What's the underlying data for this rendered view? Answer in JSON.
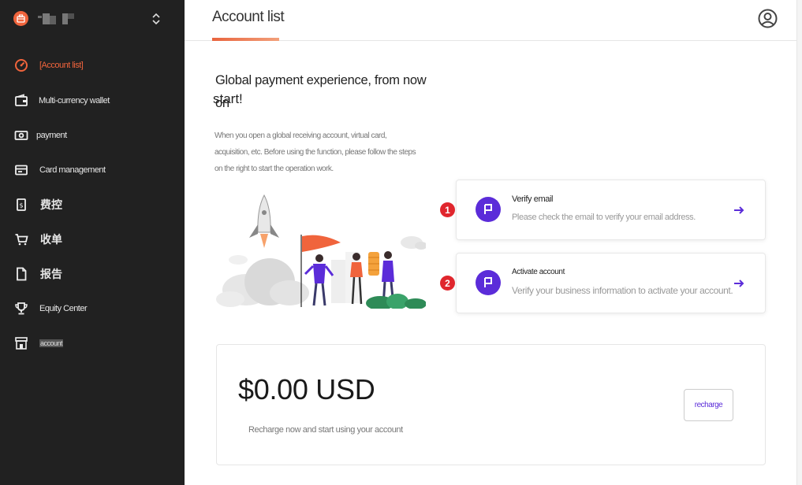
{
  "sidebar": {
    "items": [
      {
        "label": "[Account list]",
        "icon": "gauge-icon",
        "active": true
      },
      {
        "label": "Multi-currency wallet",
        "icon": "wallet-icon"
      },
      {
        "label": "payment",
        "icon": "banknote-icon"
      },
      {
        "label": "Card management",
        "icon": "card-icon"
      },
      {
        "label": "费控",
        "icon": "receipt-icon"
      },
      {
        "label": "收单",
        "icon": "cart-icon"
      },
      {
        "label": "报告",
        "icon": "report-icon"
      },
      {
        "label": "Equity Center",
        "icon": "trophy-icon"
      },
      {
        "label": "account",
        "icon": "store-icon"
      }
    ]
  },
  "header": {
    "title": "Account list",
    "avatar_icon": "user-circle-icon"
  },
  "hero": {
    "title_line1": "Global payment experience, from now on",
    "title_line2": "start!",
    "description": "When you open a global receiving account, virtual card, acquisition, etc. Before using the function, please follow the steps on the right to start the operation work."
  },
  "steps": [
    {
      "number": "1",
      "title": "Verify email",
      "description": "Please check the email to verify your email address.",
      "icon": "flag-icon"
    },
    {
      "number": "2",
      "title": "Activate account",
      "description": "Verify your business information to activate your account.",
      "icon": "flag-icon"
    }
  ],
  "balance": {
    "amount": "$0.00 USD",
    "hint": "Recharge now and start using your account",
    "recharge_label": "recharge"
  },
  "colors": {
    "accent": "#f0643c",
    "primary": "#5b2cd9",
    "sidebar_bg": "#212121",
    "step_badge": "#e0262d"
  }
}
